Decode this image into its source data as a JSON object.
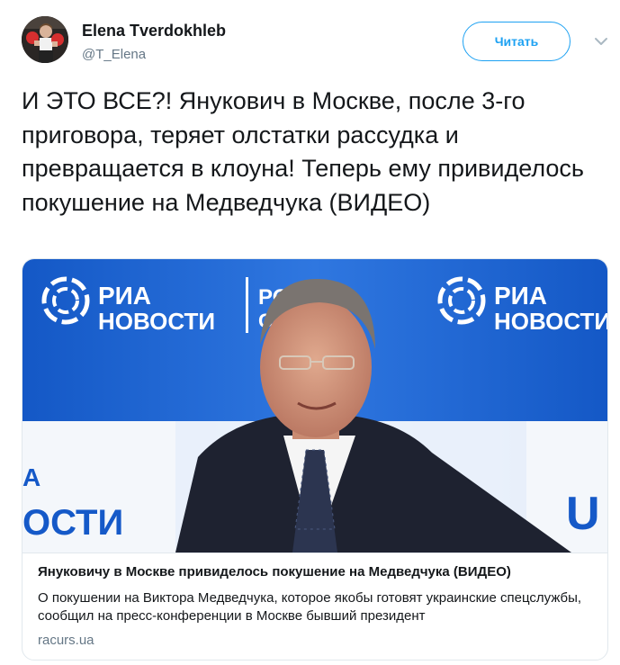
{
  "author": {
    "display_name": "Elena Tverdokhleb",
    "handle": "@T_Elena"
  },
  "follow_button": {
    "label": "Читать"
  },
  "tweet": {
    "text": "И ЭТО ВСЕ?! Янукович в Москве, после 3-го приговора, теряет олстатки рассудка и превращается в клоуна! Теперь ему привиделось покушение на Медведчука (ВИДЕО)"
  },
  "card": {
    "title": "Януковичу в Москве привиделось покушение на Медведчука (ВИДЕО)",
    "description": "О покушении на Виктора Медведчука, которое якобы готовят украинские спецслужбы, сообщил на пресс-конференции в Москве бывший президент",
    "domain": "racurs.ua",
    "image": {
      "logo_left_line1": "РИА",
      "logo_left_line2": "НОВОСТИ",
      "logo_mid_line1": "РОС",
      "logo_mid_line2": "СЕГ",
      "logo_right_line1": "РИА",
      "logo_right_line2": "НОВОСТИ",
      "logo_bottom_left_line1": "А",
      "logo_bottom_left_line2": "ОСТИ",
      "logo_bottom_right": "U"
    }
  },
  "colors": {
    "accent": "#1da1f2",
    "text": "#14171a",
    "muted": "#657786",
    "border": "#e1e8ed",
    "ria_background": "#1559c8"
  },
  "icons": {
    "caret": "chevron-down-icon",
    "ria_logo": "ria-globe-icon"
  }
}
